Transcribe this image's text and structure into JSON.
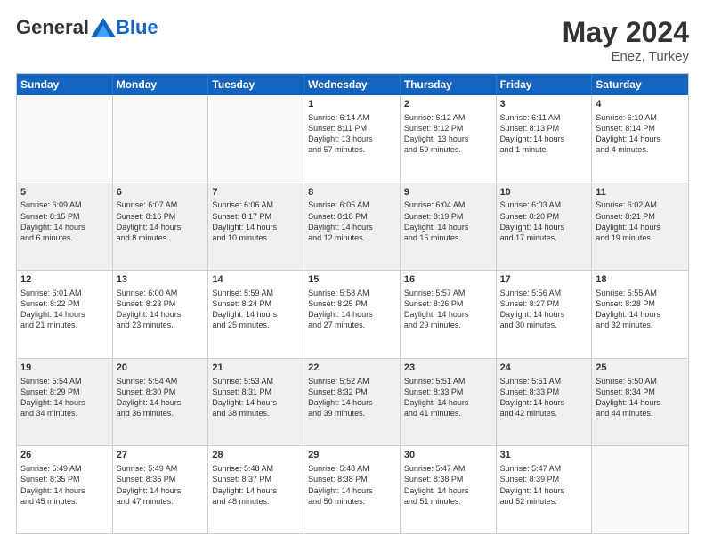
{
  "header": {
    "logo_general": "General",
    "logo_blue": "Blue",
    "month_title": "May 2024",
    "location": "Enez, Turkey"
  },
  "days_of_week": [
    "Sunday",
    "Monday",
    "Tuesday",
    "Wednesday",
    "Thursday",
    "Friday",
    "Saturday"
  ],
  "rows": [
    [
      {
        "day": "",
        "text": ""
      },
      {
        "day": "",
        "text": ""
      },
      {
        "day": "",
        "text": ""
      },
      {
        "day": "1",
        "text": "Sunrise: 6:14 AM\nSunset: 8:11 PM\nDaylight: 13 hours\nand 57 minutes."
      },
      {
        "day": "2",
        "text": "Sunrise: 6:12 AM\nSunset: 8:12 PM\nDaylight: 13 hours\nand 59 minutes."
      },
      {
        "day": "3",
        "text": "Sunrise: 6:11 AM\nSunset: 8:13 PM\nDaylight: 14 hours\nand 1 minute."
      },
      {
        "day": "4",
        "text": "Sunrise: 6:10 AM\nSunset: 8:14 PM\nDaylight: 14 hours\nand 4 minutes."
      }
    ],
    [
      {
        "day": "5",
        "text": "Sunrise: 6:09 AM\nSunset: 8:15 PM\nDaylight: 14 hours\nand 6 minutes."
      },
      {
        "day": "6",
        "text": "Sunrise: 6:07 AM\nSunset: 8:16 PM\nDaylight: 14 hours\nand 8 minutes."
      },
      {
        "day": "7",
        "text": "Sunrise: 6:06 AM\nSunset: 8:17 PM\nDaylight: 14 hours\nand 10 minutes."
      },
      {
        "day": "8",
        "text": "Sunrise: 6:05 AM\nSunset: 8:18 PM\nDaylight: 14 hours\nand 12 minutes."
      },
      {
        "day": "9",
        "text": "Sunrise: 6:04 AM\nSunset: 8:19 PM\nDaylight: 14 hours\nand 15 minutes."
      },
      {
        "day": "10",
        "text": "Sunrise: 6:03 AM\nSunset: 8:20 PM\nDaylight: 14 hours\nand 17 minutes."
      },
      {
        "day": "11",
        "text": "Sunrise: 6:02 AM\nSunset: 8:21 PM\nDaylight: 14 hours\nand 19 minutes."
      }
    ],
    [
      {
        "day": "12",
        "text": "Sunrise: 6:01 AM\nSunset: 8:22 PM\nDaylight: 14 hours\nand 21 minutes."
      },
      {
        "day": "13",
        "text": "Sunrise: 6:00 AM\nSunset: 8:23 PM\nDaylight: 14 hours\nand 23 minutes."
      },
      {
        "day": "14",
        "text": "Sunrise: 5:59 AM\nSunset: 8:24 PM\nDaylight: 14 hours\nand 25 minutes."
      },
      {
        "day": "15",
        "text": "Sunrise: 5:58 AM\nSunset: 8:25 PM\nDaylight: 14 hours\nand 27 minutes."
      },
      {
        "day": "16",
        "text": "Sunrise: 5:57 AM\nSunset: 8:26 PM\nDaylight: 14 hours\nand 29 minutes."
      },
      {
        "day": "17",
        "text": "Sunrise: 5:56 AM\nSunset: 8:27 PM\nDaylight: 14 hours\nand 30 minutes."
      },
      {
        "day": "18",
        "text": "Sunrise: 5:55 AM\nSunset: 8:28 PM\nDaylight: 14 hours\nand 32 minutes."
      }
    ],
    [
      {
        "day": "19",
        "text": "Sunrise: 5:54 AM\nSunset: 8:29 PM\nDaylight: 14 hours\nand 34 minutes."
      },
      {
        "day": "20",
        "text": "Sunrise: 5:54 AM\nSunset: 8:30 PM\nDaylight: 14 hours\nand 36 minutes."
      },
      {
        "day": "21",
        "text": "Sunrise: 5:53 AM\nSunset: 8:31 PM\nDaylight: 14 hours\nand 38 minutes."
      },
      {
        "day": "22",
        "text": "Sunrise: 5:52 AM\nSunset: 8:32 PM\nDaylight: 14 hours\nand 39 minutes."
      },
      {
        "day": "23",
        "text": "Sunrise: 5:51 AM\nSunset: 8:33 PM\nDaylight: 14 hours\nand 41 minutes."
      },
      {
        "day": "24",
        "text": "Sunrise: 5:51 AM\nSunset: 8:33 PM\nDaylight: 14 hours\nand 42 minutes."
      },
      {
        "day": "25",
        "text": "Sunrise: 5:50 AM\nSunset: 8:34 PM\nDaylight: 14 hours\nand 44 minutes."
      }
    ],
    [
      {
        "day": "26",
        "text": "Sunrise: 5:49 AM\nSunset: 8:35 PM\nDaylight: 14 hours\nand 45 minutes."
      },
      {
        "day": "27",
        "text": "Sunrise: 5:49 AM\nSunset: 8:36 PM\nDaylight: 14 hours\nand 47 minutes."
      },
      {
        "day": "28",
        "text": "Sunrise: 5:48 AM\nSunset: 8:37 PM\nDaylight: 14 hours\nand 48 minutes."
      },
      {
        "day": "29",
        "text": "Sunrise: 5:48 AM\nSunset: 8:38 PM\nDaylight: 14 hours\nand 50 minutes."
      },
      {
        "day": "30",
        "text": "Sunrise: 5:47 AM\nSunset: 8:38 PM\nDaylight: 14 hours\nand 51 minutes."
      },
      {
        "day": "31",
        "text": "Sunrise: 5:47 AM\nSunset: 8:39 PM\nDaylight: 14 hours\nand 52 minutes."
      },
      {
        "day": "",
        "text": ""
      }
    ]
  ]
}
